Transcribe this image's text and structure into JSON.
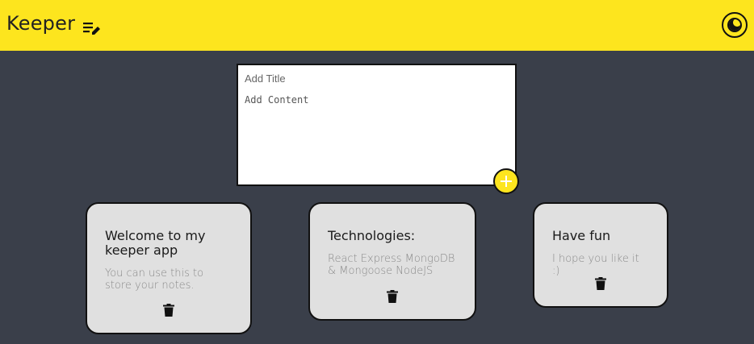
{
  "header": {
    "brand": "Keeper",
    "brand_icon": "edit-note-icon",
    "theme_icon": "moon-icon",
    "background": "#fde51e"
  },
  "composer": {
    "title_placeholder": "Add Title",
    "content_placeholder": "Add Content",
    "add_icon": "plus-icon"
  },
  "notes": [
    {
      "title": "Welcome to my keeper app",
      "content": "You can use this to store your notes.",
      "delete_icon": "trash-icon"
    },
    {
      "title": "Technologies:",
      "content": "React Express MongoDB & Mongoose NodeJS",
      "delete_icon": "trash-icon"
    },
    {
      "title": "Have fun",
      "content": "I hope you like it :)",
      "delete_icon": "trash-icon"
    }
  ],
  "colors": {
    "background": "#3a3f4a",
    "card": "#e0e0e0",
    "accent": "#fde51e"
  }
}
